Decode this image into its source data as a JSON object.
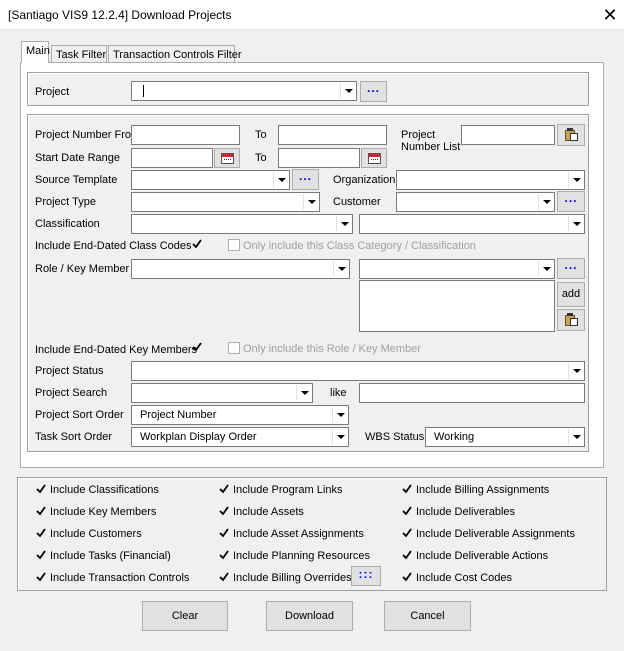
{
  "window": {
    "title": "[Santiago VIS9 12.2.4] Download Projects",
    "close_glyph": "✕"
  },
  "tabs": [
    {
      "label": "Main",
      "active": true
    },
    {
      "label": "Task Filter",
      "active": false
    },
    {
      "label": "Transaction Controls Filter",
      "active": false
    }
  ],
  "project_section": {
    "label": "Project",
    "value": ""
  },
  "filters": {
    "project_number_from": {
      "label": "Project Number From",
      "value": ""
    },
    "to_label": "To",
    "project_number_to": {
      "value": ""
    },
    "project_number_list": {
      "label_line1": "Project",
      "label_line2": "Number List",
      "value": ""
    },
    "start_date_range": {
      "label": "Start Date Range",
      "from": "",
      "to": ""
    },
    "source_template": {
      "label": "Source Template",
      "value": ""
    },
    "organization": {
      "label": "Organization",
      "value": ""
    },
    "project_type": {
      "label": "Project Type",
      "value": ""
    },
    "customer": {
      "label": "Customer",
      "value": ""
    },
    "classification": {
      "label": "Classification",
      "value": "",
      "value2": ""
    },
    "include_end_dated_class_codes": {
      "label": "Include End-Dated Class Codes",
      "checked": true
    },
    "only_include_class_category": {
      "label": "Only include this Class Category / Classification",
      "checked": false
    },
    "role_key_member": {
      "label": "Role / Key Member",
      "value": "",
      "value2": ""
    },
    "add_label": "add",
    "include_end_dated_key_members": {
      "label": "Include End-Dated Key Members",
      "checked": true
    },
    "only_include_role": {
      "label": "Only include this Role / Key Member",
      "checked": false
    },
    "project_status": {
      "label": "Project Status",
      "value": ""
    },
    "project_search": {
      "label": "Project Search",
      "value": "",
      "like_label": "like",
      "like_value": ""
    },
    "project_sort_order": {
      "label": "Project Sort Order",
      "value": "Project Number"
    },
    "task_sort_order": {
      "label": "Task Sort Order",
      "value": "Workplan Display Order"
    },
    "wbs_status": {
      "label": "WBS Status",
      "value": "Working"
    }
  },
  "options": {
    "col1": [
      {
        "label": "Include Classifications",
        "checked": true
      },
      {
        "label": "Include Key Members",
        "checked": true
      },
      {
        "label": "Include Customers",
        "checked": true
      },
      {
        "label": "Include Tasks (Financial)",
        "checked": true
      },
      {
        "label": "Include Transaction Controls",
        "checked": true
      }
    ],
    "col2": [
      {
        "label": "Include Program Links",
        "checked": true
      },
      {
        "label": "Include Assets",
        "checked": true
      },
      {
        "label": "Include Asset Assignments",
        "checked": true
      },
      {
        "label": "Include Planning Resources",
        "checked": true
      },
      {
        "label": "Include Billing Overrides",
        "checked": true
      }
    ],
    "col3": [
      {
        "label": "Include Billing Assignments",
        "checked": true
      },
      {
        "label": "Include Deliverables",
        "checked": true
      },
      {
        "label": "Include Deliverable Assignments",
        "checked": true
      },
      {
        "label": "Include Deliverable Actions",
        "checked": true
      },
      {
        "label": "Include Cost Codes",
        "checked": true
      }
    ]
  },
  "ellipsis_label": "...",
  "billing_overrides_button": ":::",
  "buttons": {
    "clear": "Clear",
    "download": "Download",
    "cancel": "Cancel"
  },
  "colors": {
    "accent": "#0078d7",
    "ellipsis": "#0000ff",
    "disabled_text": "#a0a0a0"
  },
  "icons": [
    "close-icon",
    "calendar-icon",
    "paste-icon",
    "dropdown-arrow-icon",
    "checkmark-icon"
  ]
}
